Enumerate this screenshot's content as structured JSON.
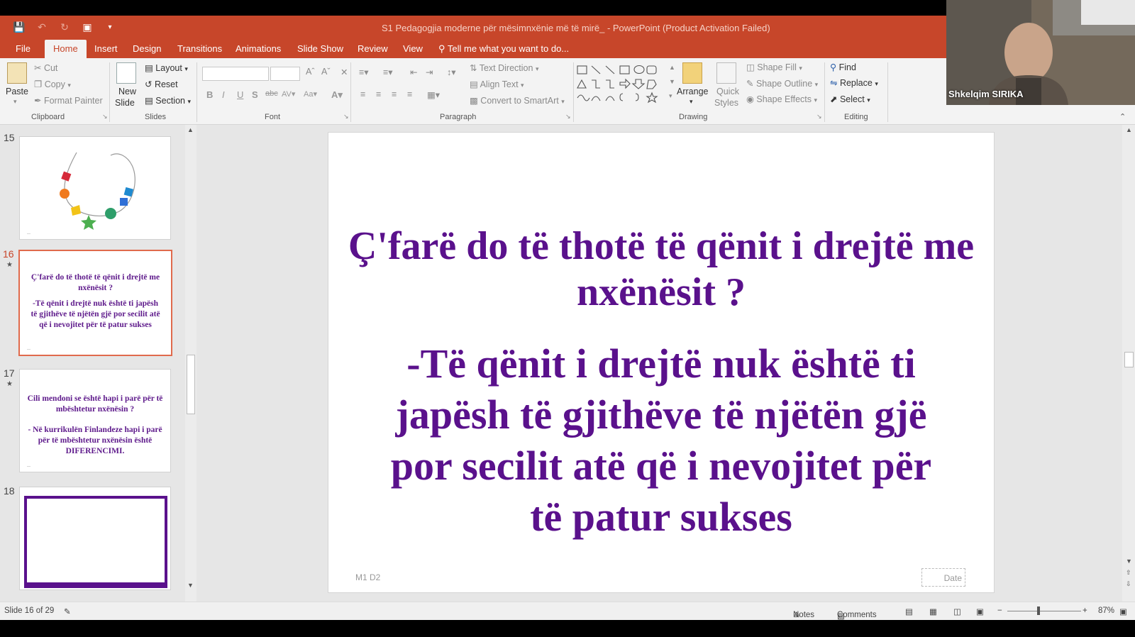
{
  "window": {
    "title": "S1 Pedagogjia moderne për mësimnxënie më të mirë_ - PowerPoint (Product Activation Failed)"
  },
  "tabs": [
    "File",
    "Home",
    "Insert",
    "Design",
    "Transitions",
    "Animations",
    "Slide Show",
    "Review",
    "View"
  ],
  "tell_me": "Tell me what you want to do...",
  "ribbon": {
    "clipboard": {
      "paste": "Paste",
      "cut": "Cut",
      "copy": "Copy",
      "format_painter": "Format Painter",
      "label": "Clipboard"
    },
    "slides": {
      "new_slide_1": "New",
      "new_slide_2": "Slide",
      "layout": "Layout",
      "reset": "Reset",
      "section": "Section",
      "label": "Slides"
    },
    "font": {
      "label": "Font"
    },
    "paragraph": {
      "text_direction": "Text Direction",
      "align_text": "Align Text",
      "convert_smartart": "Convert to SmartArt",
      "label": "Paragraph"
    },
    "drawing": {
      "arrange": "Arrange",
      "quick_styles_1": "Quick",
      "quick_styles_2": "Styles",
      "shape_fill": "Shape Fill",
      "shape_outline": "Shape Outline",
      "shape_effects": "Shape Effects",
      "label": "Drawing"
    },
    "editing": {
      "find": "Find",
      "replace": "Replace",
      "select": "Select",
      "label": "Editing"
    }
  },
  "thumbnails": [
    {
      "number": "15",
      "text": "",
      "body": ""
    },
    {
      "number": "16",
      "text": "Ç'farë do të thotë të qënit i drejtë me nxënësit ?",
      "body": "-Të qënit i drejtë nuk është ti japësh të gjithëve të njëtën gjë por secilit atë që i nevojitet për të patur sukses"
    },
    {
      "number": "17",
      "text": "Cili mendoni se është hapi i parë për të mbështetur nxënësin ?",
      "body": "- Në kurrikulën Finlandeze hapi i parë për të mbështetur nxënësin është DIFERENCIMI."
    },
    {
      "number": "18",
      "text": "",
      "body": ""
    }
  ],
  "slide": {
    "title": "Ç'farë do të thotë të qënit i drejtë me nxënësit ?",
    "body": "-Të qënit i drejtë nuk është ti japësh të gjithëve të njëtën gjë por secilit atë që i nevojitet për të patur sukses",
    "footer": "M1 D2",
    "date": "Date"
  },
  "status": {
    "slide_indicator": "Slide 16 of 29",
    "notes": "Notes",
    "comments": "Comments",
    "zoom": "87%"
  },
  "webcam": {
    "name": "Shkelqim SIRIKA"
  },
  "colors": {
    "accent": "#c7462a",
    "slide_text": "#5a118c",
    "selection": "#e06a4c"
  }
}
